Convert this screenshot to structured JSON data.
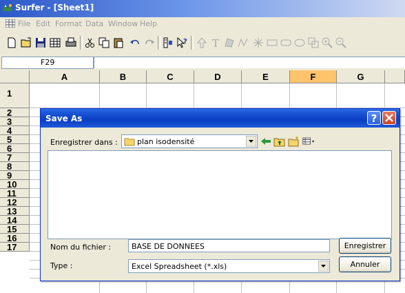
{
  "window": {
    "title": "Surfer - [Sheet1]"
  },
  "menu": {
    "items": [
      "File",
      "Edit",
      "Format",
      "Data",
      "Window",
      "Help"
    ]
  },
  "formula_bar": {
    "cell_ref": "F29",
    "value": ""
  },
  "sheet": {
    "columns": [
      "A",
      "B",
      "C",
      "D",
      "E",
      "F",
      "G"
    ],
    "rows": [
      "1",
      "2",
      "3",
      "4",
      "5",
      "6",
      "7",
      "8",
      "9",
      "10",
      "11",
      "12",
      "13",
      "14",
      "15",
      "16",
      "17"
    ]
  },
  "dialog": {
    "title": "Save As",
    "help_label": "?",
    "save_in_label": "Enregistrer dans :",
    "save_in_value": "plan isodensité",
    "filename_label": "Nom du fichier :",
    "filename_value": "BASE DE DONNEES",
    "type_label": "Type :",
    "type_value": "Excel Spreadsheet (*.xls)",
    "save_button": "Enregistrer",
    "cancel_button": "Annuler"
  },
  "colors": {
    "titlebar": "#2c59c9",
    "dialog_title": "#0a3fc4",
    "close_button": "#c8412a",
    "chrome": "#ece9d8"
  }
}
